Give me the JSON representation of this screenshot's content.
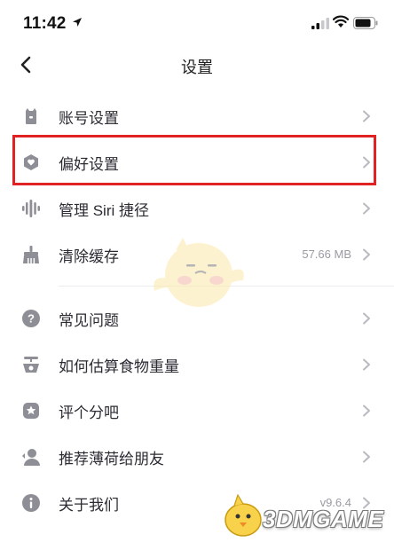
{
  "status_bar": {
    "time": "11:42"
  },
  "header": {
    "title": "设置"
  },
  "items": [
    {
      "label": "账号设置",
      "icon": "account-icon"
    },
    {
      "label": "偏好设置",
      "icon": "preference-icon"
    },
    {
      "label": "管理 Siri 捷径",
      "icon": "siri-icon"
    },
    {
      "label": "清除缓存",
      "icon": "broom-icon",
      "value": "57.66 MB"
    },
    {
      "label": "常见问题",
      "icon": "question-icon"
    },
    {
      "label": "如何估算食物重量",
      "icon": "scale-icon"
    },
    {
      "label": "评个分吧",
      "icon": "rate-icon"
    },
    {
      "label": "推荐薄荷给朋友",
      "icon": "recommend-icon"
    },
    {
      "label": "关于我们",
      "icon": "info-icon",
      "value": "v9.6.4"
    }
  ],
  "highlighted_item": "偏好设置",
  "colors": {
    "icon": "#8e8e96",
    "highlight": "#e02222",
    "text": "#2b2b33",
    "secondary": "#9a9aa2"
  },
  "watermark": {
    "text": "3DMGAME"
  }
}
